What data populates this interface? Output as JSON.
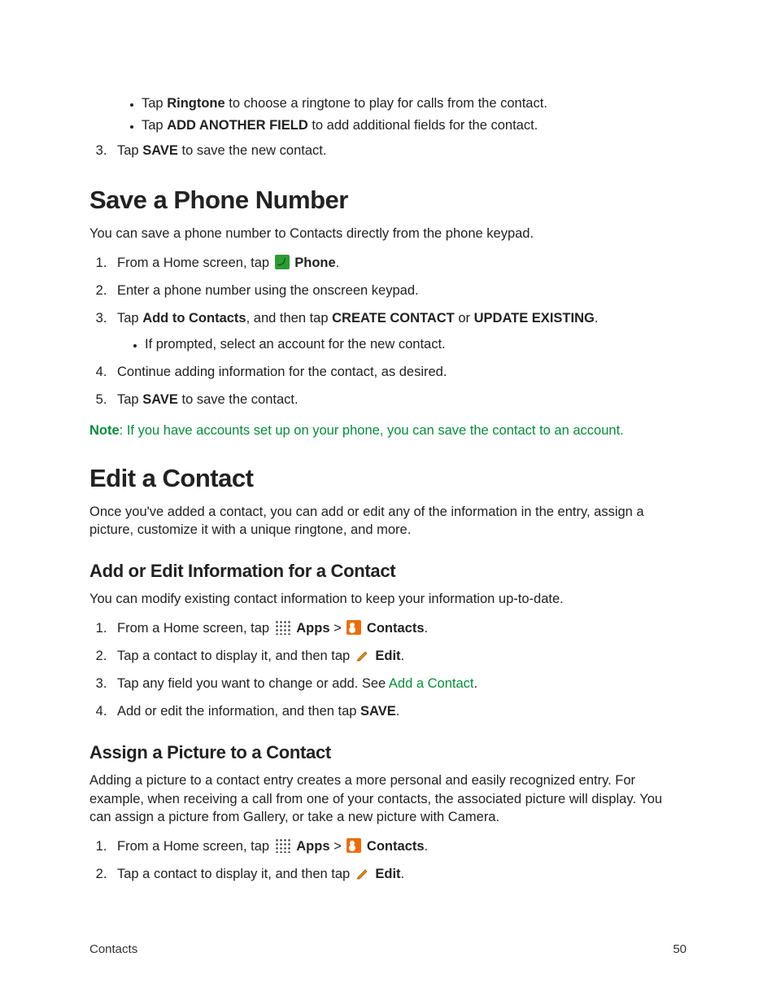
{
  "bullets_top": {
    "b1_prefix": "Tap ",
    "b1_bold": "Ringtone",
    "b1_suffix": " to choose a ringtone to play for calls from the contact.",
    "b2_prefix": "Tap ",
    "b2_bold": "ADD ANOTHER FIELD",
    "b2_suffix": " to add additional fields for the contact."
  },
  "step3_top": {
    "prefix": "Tap ",
    "bold": "SAVE",
    "suffix": " to save the new contact."
  },
  "save_number": {
    "heading": "Save a Phone Number",
    "intro": "You can save a phone number to Contacts directly from the phone keypad.",
    "s1_prefix": "From a Home screen, tap ",
    "s1_bold": "Phone",
    "s1_suffix": ".",
    "s2": "Enter a phone number using the onscreen keypad.",
    "s3_prefix": "Tap ",
    "s3_bold1": "Add to Contacts",
    "s3_mid1": ", and then tap ",
    "s3_bold2": "CREATE CONTACT",
    "s3_mid2": " or ",
    "s3_bold3": "UPDATE EXISTING",
    "s3_suffix": ".",
    "s3_sub": "If prompted, select an account for the new contact.",
    "s4": "Continue adding information for the contact, as desired.",
    "s5_prefix": "Tap ",
    "s5_bold": "SAVE",
    "s5_suffix": " to save the contact.",
    "note_bold": "Note",
    "note_rest": ": If you have accounts set up on your phone, you can save the contact to an account."
  },
  "edit_contact": {
    "heading": "Edit a Contact",
    "intro": "Once you've added a contact, you can add or edit any of the information in the entry, assign a picture, customize it with a unique ringtone, and more."
  },
  "add_edit_info": {
    "heading": "Add or Edit Information for a Contact",
    "intro": "You can modify existing contact information to keep your information up-to-date.",
    "s1_prefix": "From a Home screen, tap ",
    "s1_bold1": "Apps",
    "s1_sep": " > ",
    "s1_bold2": "Contacts",
    "s1_suffix": ".",
    "s2_prefix": "Tap a contact to display it, and then tap ",
    "s2_bold": "Edit",
    "s2_suffix": ".",
    "s3_prefix": "Tap any field you want to change or add. See ",
    "s3_link": "Add a Contact",
    "s3_suffix": ".",
    "s4_prefix": "Add or edit the information, and then tap ",
    "s4_bold": "SAVE",
    "s4_suffix": "."
  },
  "assign_pic": {
    "heading": "Assign a Picture to a Contact",
    "intro": "Adding a picture to a contact entry creates a more personal and easily recognized entry. For example, when receiving a call from one of your contacts, the associated picture will display. You can assign a picture from Gallery, or take a new picture with Camera.",
    "s1_prefix": "From a Home screen, tap ",
    "s1_bold1": "Apps",
    "s1_sep": " > ",
    "s1_bold2": "Contacts",
    "s1_suffix": ".",
    "s2_prefix": "Tap a contact to display it, and then tap ",
    "s2_bold": "Edit",
    "s2_suffix": "."
  },
  "footer": {
    "section": "Contacts",
    "page": "50"
  }
}
